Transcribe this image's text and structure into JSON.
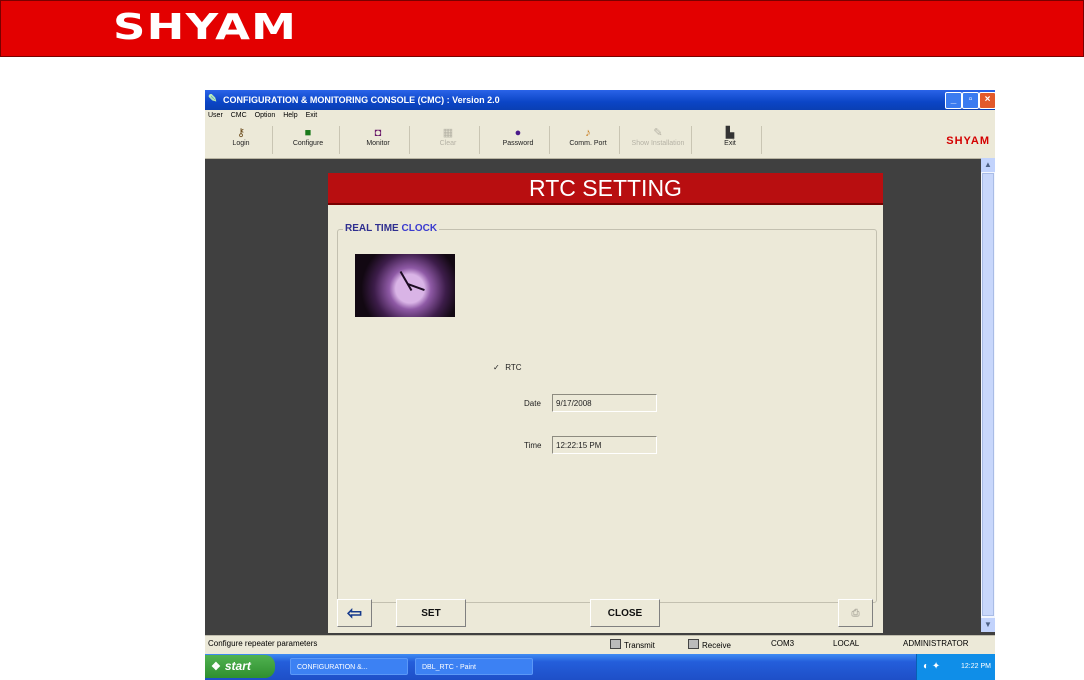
{
  "banner": {
    "logo": "SHYAM"
  },
  "window": {
    "title": "CONFIGURATION & MONITORING CONSOLE (CMC) : Version 2.0",
    "menu": [
      "User",
      "CMC",
      "Option",
      "Help",
      "Exit"
    ],
    "toolbar": [
      {
        "label": "Login",
        "icon": "login-icon",
        "enabled": true
      },
      {
        "label": "Configure",
        "icon": "configure-icon",
        "enabled": true
      },
      {
        "label": "Monitor",
        "icon": "monitor-icon",
        "enabled": true
      },
      {
        "label": "Clear",
        "icon": "clear-icon",
        "enabled": false
      },
      {
        "label": "Password",
        "icon": "password-icon",
        "enabled": true
      },
      {
        "label": "Comm. Port",
        "icon": "comm-port-icon",
        "enabled": true
      },
      {
        "label": "Show Installation",
        "icon": "installation-icon",
        "enabled": false
      },
      {
        "label": "Exit",
        "icon": "exit-icon",
        "enabled": true
      }
    ],
    "brand": "SHYAM"
  },
  "dialog": {
    "title": "RTC SETTING",
    "group_title_1": "REAL TIME",
    "group_title_2": "CLOCK",
    "rtc_checkbox_label": "RTC",
    "rtc_checked": true,
    "date_label": "Date",
    "date_value": "9/17/2008",
    "time_label": "Time",
    "time_value": "12:22:15 PM",
    "set_button": "SET",
    "close_button": "CLOSE"
  },
  "statusbar": {
    "message": "Configure repeater parameters",
    "transmit": "Transmit",
    "receive": "Receive",
    "port": "COM3",
    "mode": "LOCAL",
    "user": "ADMINISTRATOR"
  },
  "taskbar": {
    "start": "start",
    "tasks": [
      "CONFIGURATION &...",
      "DBL_RTC - Paint"
    ],
    "clock": "12:22 PM"
  },
  "colors": {
    "banner_red": "#e30000",
    "dialog_header_red": "#b80e10",
    "group_title_blue": "#3b3bcf"
  }
}
